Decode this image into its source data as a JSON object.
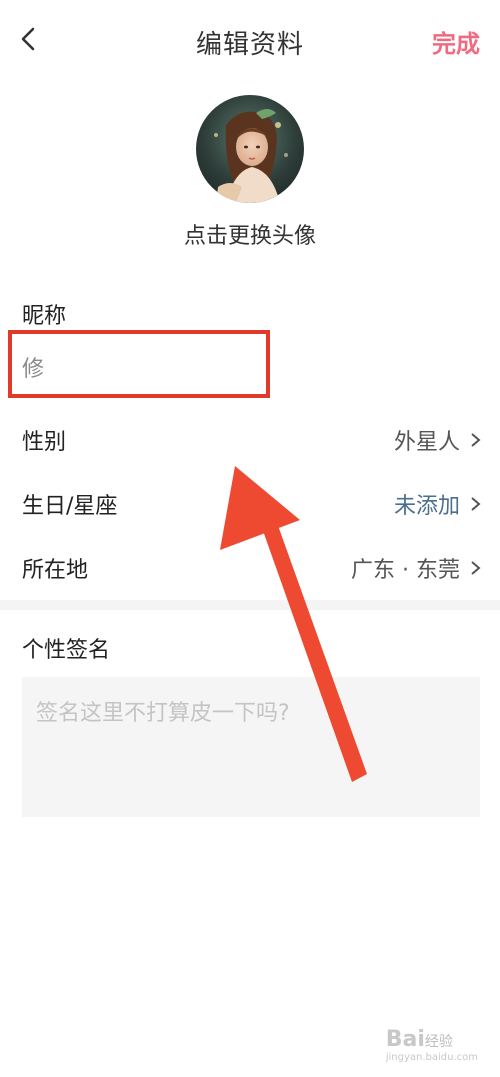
{
  "header": {
    "title": "编辑资料",
    "done_label": "完成"
  },
  "avatar": {
    "caption": "点击更换头像"
  },
  "nickname": {
    "label": "昵称",
    "value": "修"
  },
  "fields": [
    {
      "label": "性别",
      "value": "外星人"
    },
    {
      "label": "生日/星座",
      "value": "未添加"
    },
    {
      "label": "所在地",
      "value": "广东 · 东莞"
    }
  ],
  "signature": {
    "label": "个性签名",
    "placeholder": "签名这里不打算皮一下吗?"
  },
  "colors": {
    "accent": "#f06b7f",
    "annotation": "#e13a2a",
    "value_blue": "#4a6f8f"
  },
  "watermark": {
    "brand": "Bai",
    "suffix": "经验",
    "url": "jingyan.baidu.com"
  }
}
